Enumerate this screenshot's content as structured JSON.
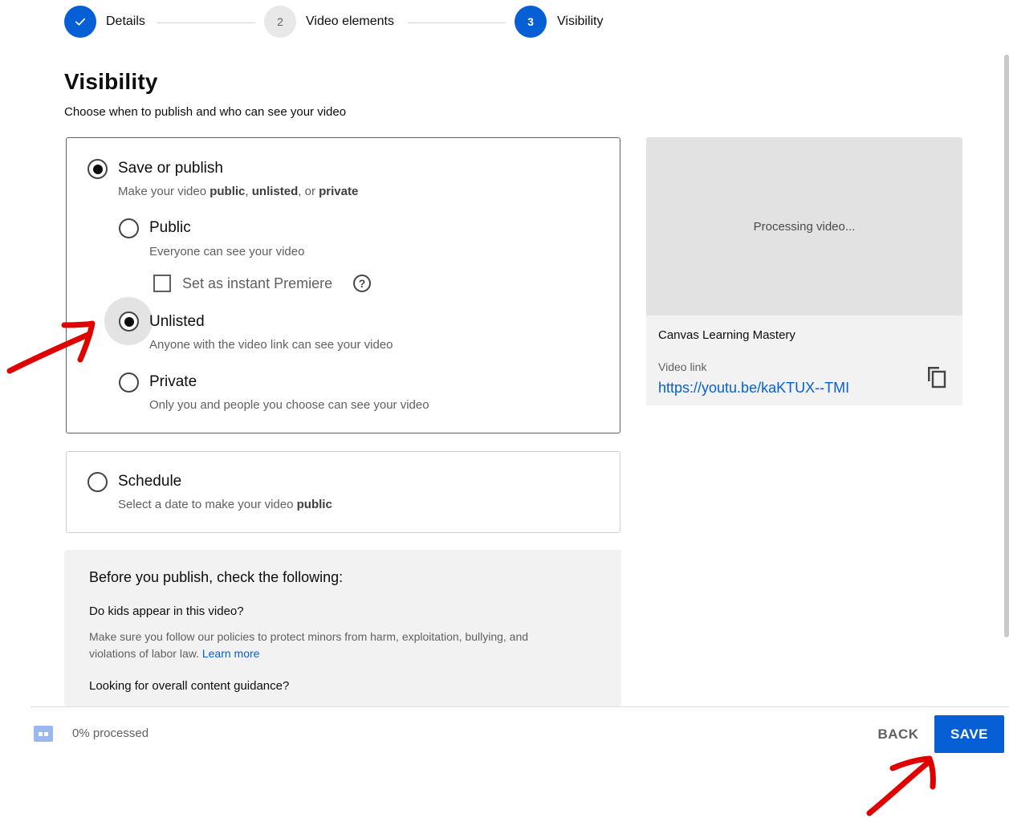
{
  "stepper": {
    "steps": [
      {
        "number": "",
        "label": "Details",
        "state": "done"
      },
      {
        "number": "2",
        "label": "Video elements",
        "state": "inactive"
      },
      {
        "number": "3",
        "label": "Visibility",
        "state": "active"
      }
    ]
  },
  "page": {
    "title": "Visibility",
    "subtitle": "Choose when to publish and who can see your video"
  },
  "save_or_publish": {
    "title": "Save or publish",
    "desc_prefix": "Make your video ",
    "desc_public": "public",
    "desc_sep1": ", ",
    "desc_unlisted": "unlisted",
    "desc_sep2": ", or ",
    "desc_private": "private",
    "options": {
      "public": {
        "title": "Public",
        "desc": "Everyone can see your video"
      },
      "premiere": {
        "label": "Set as instant Premiere",
        "checked": false
      },
      "unlisted": {
        "title": "Unlisted",
        "desc": "Anyone with the video link can see your video"
      },
      "private": {
        "title": "Private",
        "desc": "Only you and people you choose can see your video"
      }
    },
    "selected": "unlisted"
  },
  "schedule": {
    "title": "Schedule",
    "desc_prefix": "Select a date to make your video ",
    "desc_bold": "public"
  },
  "preview": {
    "status": "Processing video...",
    "video_title": "Canvas Learning Mastery",
    "link_label": "Video link",
    "link": "https://youtu.be/kaKTUX--TMI"
  },
  "checklist": {
    "title": "Before you publish, check the following:",
    "q1": "Do kids appear in this video?",
    "q1_text": "Make sure you follow our policies to protect minors from harm, exploitation, bullying, and violations of labor law.",
    "learn_more": "Learn more",
    "q2": "Looking for overall content guidance?"
  },
  "footer": {
    "progress_text": "0% processed",
    "back_label": "BACK",
    "save_label": "SAVE"
  },
  "colors": {
    "accent": "#065fd4",
    "annotation": "#e00000"
  },
  "icons": {
    "step_done": "check-icon",
    "copy": "copy-icon",
    "help": "help-icon",
    "processing": "processing-icon"
  }
}
